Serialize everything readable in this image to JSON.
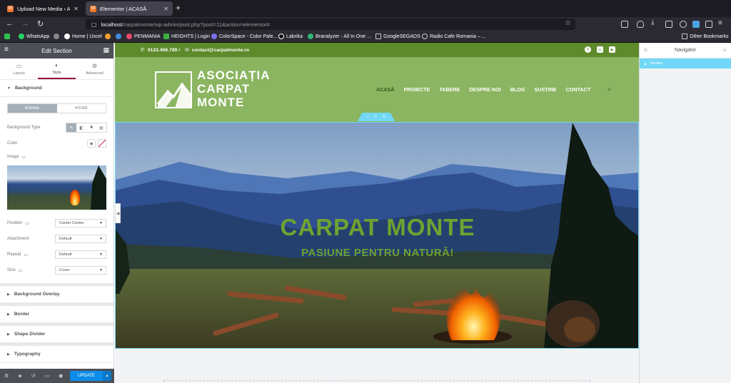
{
  "browser": {
    "tabs": [
      {
        "title": "Upload New Media ‹ Asociația",
        "active": false
      },
      {
        "title": "Elementor | ACASĂ",
        "active": true
      }
    ],
    "url_host": "localhost",
    "url_path": "/carpatmonte/wp-admin/post.php?post=11&action=elementor#",
    "bookmarks": [
      "WhatsApp",
      "Home | Uxcel",
      "PENMANIA",
      "HEIGHTS | Login",
      "ColorSpace - Color Pale...",
      "Labrika",
      "Branalyzer - All In One ...",
      "GoogleSEGADS",
      "Radio Cafe Romania – ..."
    ],
    "other_bookmarks": "Other Bookmarks"
  },
  "panel": {
    "title": "Edit Section",
    "tabs": [
      "Layout",
      "Style",
      "Advanced"
    ],
    "active_tab": "Style",
    "background_section": "Background",
    "state_tabs": [
      "NORMAL",
      "HOVER"
    ],
    "fields": {
      "background_type": "Background Type",
      "color": "Color",
      "image": "Image",
      "position": "Position",
      "position_value": "Center Center",
      "attachment": "Attachment",
      "attachment_value": "Default",
      "repeat": "Repeat",
      "repeat_value": "Default",
      "size": "Size",
      "size_value": "Cover"
    },
    "sections": [
      "Background Overlay",
      "Border",
      "Shape Divider",
      "Typography"
    ],
    "update_label": "UPDATE"
  },
  "site": {
    "phone": "0123.456.789 /",
    "email": "contact@carpatmonte.ro",
    "logo_lines": [
      "ASOCIAȚIA",
      "CARPAT",
      "MONTE"
    ],
    "menu": [
      "ACASĂ",
      "PROIECTE",
      "TABERE",
      "DESPRE NOI",
      "BLOG",
      "SUSȚINE",
      "CONTACT"
    ],
    "active_menu": "ACASĂ",
    "hero_title": "CARPAT MONTE",
    "hero_subtitle": "PASIUNE PENTRU NATURĂ!"
  },
  "navigator": {
    "title": "Navigator",
    "item": "Section"
  },
  "colors": {
    "topbar": "#5e8a2b",
    "header": "#8bb560",
    "hero_text": "#6fa231",
    "accent_selection": "#71d7f7",
    "update_button": "#0c8ce9"
  }
}
